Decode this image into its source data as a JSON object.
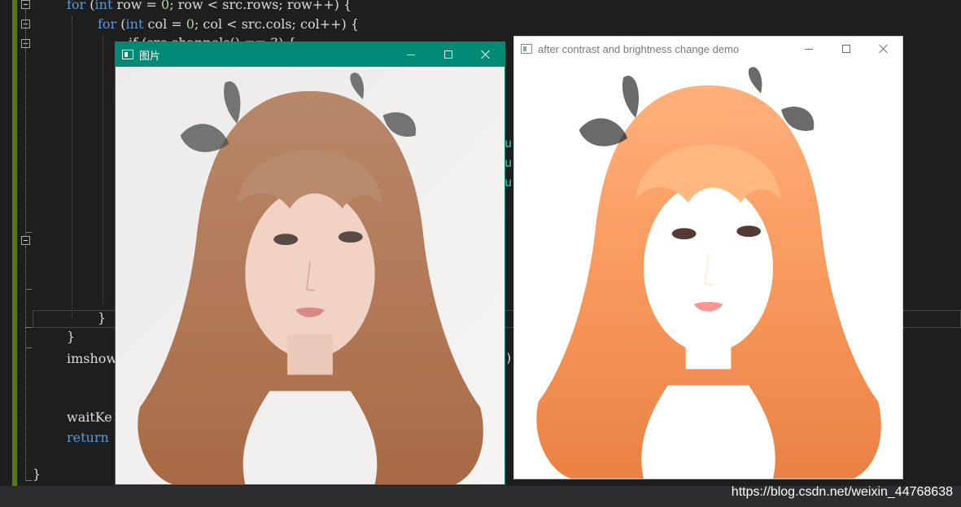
{
  "editor": {
    "lines": {
      "l1": {
        "kw1": "for",
        "p1": " (",
        "kw2": "int",
        "p2": " row = ",
        "n1": "0",
        "p3": "; row < src.rows; row++) {"
      },
      "l2": {
        "kw1": "for",
        "p1": " (",
        "kw2": "int",
        "p2": " col = ",
        "n1": "0",
        "p3": "; col < src.cols; col++) {"
      },
      "l3": {
        "text": "if (src.channels() == 3) {"
      },
      "l_close1": {
        "text": "}"
      },
      "l_close2": {
        "text": "}"
      },
      "l_imshow": {
        "text": "imshow"
      },
      "l_wait": {
        "text": "waitKe"
      },
      "l_return": {
        "kw": "return"
      },
      "l_close3": {
        "text": "}"
      }
    },
    "fragments": {
      "u1": "u",
      "u2": "u",
      "u3": "u",
      "paren": ")"
    }
  },
  "windows": [
    {
      "title": "图片",
      "state": "active",
      "accent": "#008975"
    },
    {
      "title": "after contrast and brightness change demo",
      "state": "inactive",
      "accent": "#ffffff"
    }
  ],
  "watermark": "https://blog.csdn.net/weixin_44768638"
}
